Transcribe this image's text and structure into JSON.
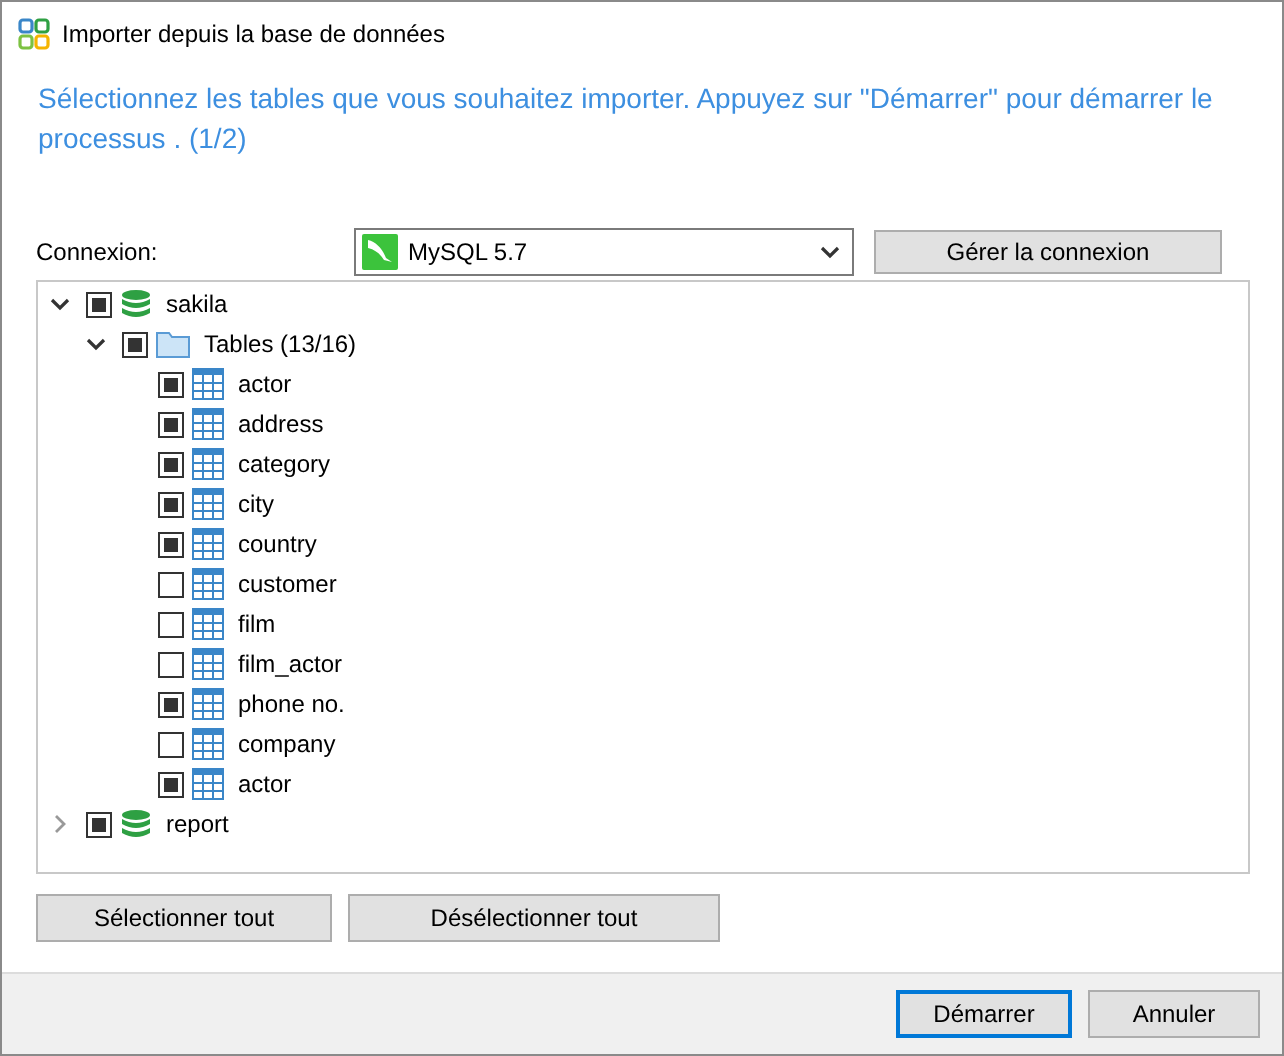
{
  "window": {
    "title": "Importer depuis la base de données"
  },
  "instruction": "Sélectionnez les tables que vous souhaitez importer. Appuyez sur \"Démarrer\" pour démarrer le processus . (1/2)",
  "connection": {
    "label": "Connexion:",
    "value": "MySQL 5.7",
    "manage_button": "Gérer la connexion"
  },
  "tree": [
    {
      "kind": "database",
      "label": "sakila",
      "checked": true,
      "expanded": true,
      "children": [
        {
          "kind": "folder",
          "label": "Tables (13/16)",
          "checked": true,
          "expanded": true,
          "children": [
            {
              "kind": "table",
              "label": "actor",
              "checked": true
            },
            {
              "kind": "table",
              "label": "address",
              "checked": true
            },
            {
              "kind": "table",
              "label": "category",
              "checked": true
            },
            {
              "kind": "table",
              "label": "city",
              "checked": true
            },
            {
              "kind": "table",
              "label": "country",
              "checked": true
            },
            {
              "kind": "table",
              "label": "customer",
              "checked": false
            },
            {
              "kind": "table",
              "label": "film",
              "checked": false
            },
            {
              "kind": "table",
              "label": "film_actor",
              "checked": false
            },
            {
              "kind": "table",
              "label": "phone no.",
              "checked": true
            },
            {
              "kind": "table",
              "label": "company",
              "checked": false
            },
            {
              "kind": "table",
              "label": "actor",
              "checked": true
            }
          ]
        }
      ]
    },
    {
      "kind": "database",
      "label": "report",
      "checked": true,
      "expanded": false
    }
  ],
  "selection_buttons": [
    "Sélectionner tout",
    "Désélectionner tout"
  ],
  "footer_buttons": [
    {
      "label": "Démarrer",
      "default": true
    },
    {
      "label": "Annuler",
      "default": false
    }
  ]
}
